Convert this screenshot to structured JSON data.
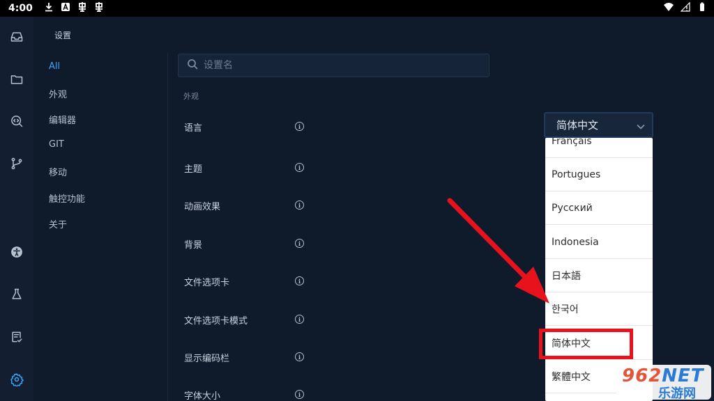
{
  "status_bar": {
    "time": "4:00",
    "notification_icons": [
      "download-icon",
      "app-store-icon",
      "bug-icon",
      "bug-icon"
    ],
    "system_icons": [
      "wifi-icon",
      "no-signal-icon",
      "battery-icon"
    ]
  },
  "rail": {
    "items": [
      {
        "icon": "inbox-icon"
      },
      {
        "icon": "folder-icon"
      },
      {
        "icon": "code-search-icon"
      },
      {
        "icon": "git-branch-icon"
      },
      {
        "icon": "accessibility-icon"
      },
      {
        "icon": "flask-icon"
      },
      {
        "icon": "document-check-icon"
      },
      {
        "icon": "gear-icon",
        "active": true
      }
    ]
  },
  "page": {
    "title": "设置"
  },
  "categories": [
    "All",
    "外观",
    "编辑器",
    "GIT",
    "移动",
    "触控功能",
    "关于"
  ],
  "search": {
    "value": "",
    "placeholder": "设置名"
  },
  "section": {
    "title": "外观"
  },
  "settings": [
    "语言",
    "主题",
    "动画效果",
    "背景",
    "文件选项卡",
    "文件选项卡模式",
    "显示编码栏",
    "字体大小"
  ],
  "language_select": {
    "selected": "简体中文",
    "options": [
      "Français",
      "Portugues",
      "Русский",
      "Indonesia",
      "日本語",
      "한국어",
      "简体中文",
      "繁體中文"
    ]
  },
  "watermark": {
    "logo_text": "962",
    "logo_suffix": "NET",
    "subtitle": "乐游网"
  },
  "colors": {
    "accent": "#3aa7ff",
    "background": "#0f1a2a",
    "annotation": "#e8121c"
  }
}
